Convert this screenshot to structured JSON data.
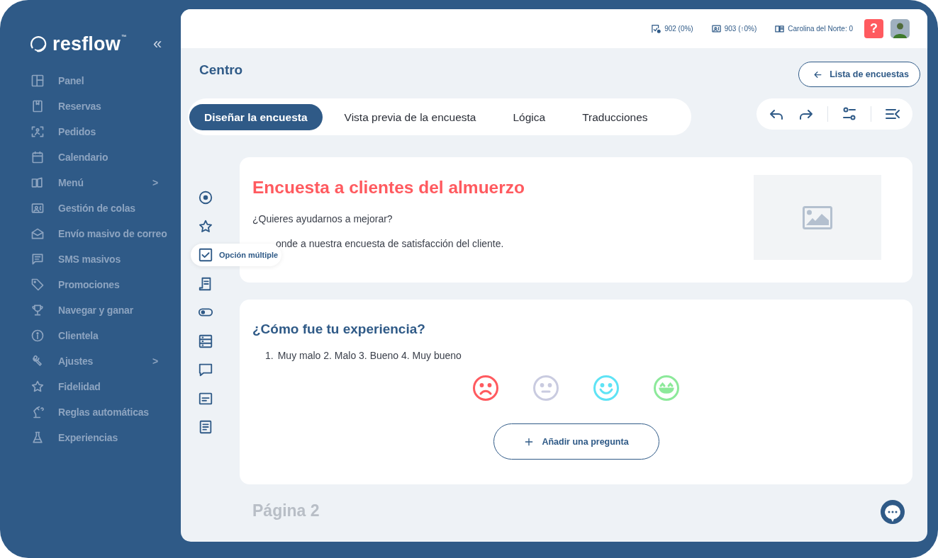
{
  "sidebar": {
    "logo": {
      "name": "resflow",
      "mark": "™"
    },
    "collapse": "«",
    "items": [
      {
        "label": "Panel"
      },
      {
        "label": "Reservas"
      },
      {
        "label": "Pedidos"
      },
      {
        "label": "Calendario"
      },
      {
        "label": "Menú",
        "arrow": ">"
      },
      {
        "label": "Gestión de colas"
      },
      {
        "label": "Envío masivo de correo"
      },
      {
        "label": "SMS masivos"
      },
      {
        "label": "Promociones"
      },
      {
        "label": "Navegar y ganar"
      },
      {
        "label": "Clientela"
      },
      {
        "label": "Ajustes",
        "arrow": ">"
      },
      {
        "label": "Fidelidad"
      },
      {
        "label": "Reglas automáticas"
      },
      {
        "label": "Experiencias"
      }
    ]
  },
  "top_bar": {
    "stats": [
      {
        "text": "902 (0%)"
      },
      {
        "text": "903 (↑0%)"
      },
      {
        "text": "Carolina del Norte: 0"
      }
    ],
    "help": "?"
  },
  "page": {
    "title": "Centro",
    "back_button": "Lista de encuestas",
    "tabs": [
      {
        "label": "Diseñar la encuesta",
        "selected": true
      },
      {
        "label": "Vista previa de la encuesta",
        "selected": false
      },
      {
        "label": "Lógica",
        "selected": false
      },
      {
        "label": "Traducciones",
        "selected": false
      }
    ]
  },
  "toolbox": {
    "tooltip": "Opción múltiple"
  },
  "intro_card": {
    "title": "Encuesta a clientes del almuerzo",
    "lines": [
      "¿Quieres ayudarnos a mejorar?",
      "onde a nuestra encuesta de satisfacción del cliente."
    ]
  },
  "question_card": {
    "question": "¿Cómo fue tu experiencia?",
    "scale_number": "1.",
    "scale": "Muy malo 2. Malo 3. Bueno 4. Muy bueno",
    "faces": [
      {
        "kind": "sad",
        "color": "#ff5a5f"
      },
      {
        "kind": "neutral",
        "color": "#c9cbe0"
      },
      {
        "kind": "smile",
        "color": "#5ee3f5"
      },
      {
        "kind": "grin",
        "color": "#8ce99a"
      }
    ],
    "add_button": "Añadir una pregunta"
  },
  "next_page": "Página 2"
}
